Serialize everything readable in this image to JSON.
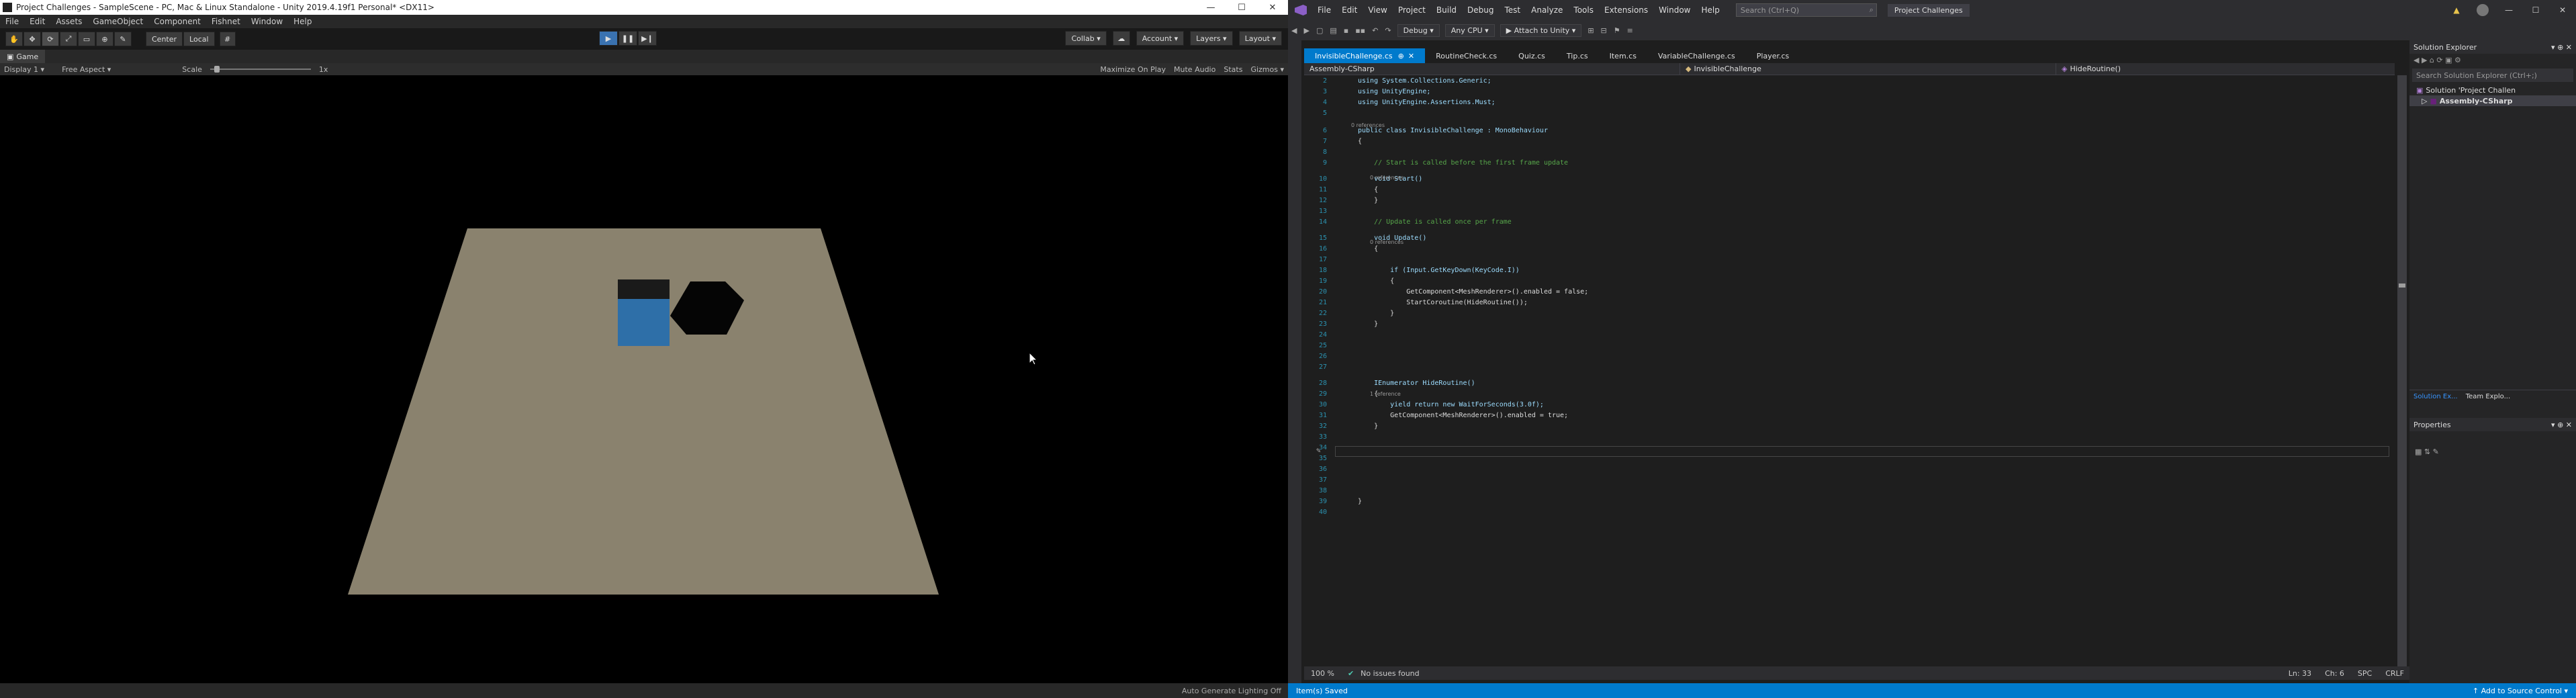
{
  "unity": {
    "title": "Project Challenges - SampleScene - PC, Mac & Linux Standalone - Unity 2019.4.19f1 Personal* <DX11>",
    "window_controls": [
      "—",
      "☐",
      "✕"
    ],
    "menu": [
      "File",
      "Edit",
      "Assets",
      "GameObject",
      "Component",
      "Fishnet",
      "Window",
      "Help"
    ],
    "toolbar": {
      "center_label": "Center",
      "local_label": "Local",
      "collab_label": "Collab ▾",
      "account_label": "Account ▾",
      "layers_label": "Layers ▾",
      "layout_label": "Layout ▾"
    },
    "game_tab": "Game",
    "game_toolbar": {
      "display": "Display 1 ▾",
      "aspect": "Free Aspect ▾",
      "scale_label": "Scale",
      "scale_value": "1x",
      "right": [
        "Maximize On Play",
        "Mute Audio",
        "Stats",
        "Gizmos ▾"
      ]
    },
    "status": "Auto Generate Lighting Off"
  },
  "vs": {
    "menu": [
      "File",
      "Edit",
      "View",
      "Project",
      "Build",
      "Debug",
      "Test",
      "Analyze",
      "Tools",
      "Extensions",
      "Window",
      "Help"
    ],
    "search_placeholder": "Search (Ctrl+Q)",
    "project_name": "Project Challenges",
    "toolbar": {
      "config": "Debug ▾",
      "platform": "Any CPU ▾",
      "attach": "▶ Attach to Unity ▾"
    },
    "tabs": [
      "InvisibleChallenge.cs",
      "RoutineCheck.cs",
      "Quiz.cs",
      "Tip.cs",
      "Item.cs",
      "VariableChallenge.cs",
      "Player.cs"
    ],
    "navbar": {
      "project": "Assembly-CSharp",
      "class": "InvisibleChallenge",
      "member": "HideRoutine()"
    },
    "code": [
      {
        "n": "2",
        "t": "using System.Collections.Generic;"
      },
      {
        "n": "3",
        "t": "using UnityEngine;"
      },
      {
        "n": "4",
        "t": "using UnityEngine.Assertions.Must;"
      },
      {
        "n": "5",
        "t": ""
      },
      {
        "n": "6",
        "t": "public class InvisibleChallenge : MonoBehaviour"
      },
      {
        "n": "7",
        "t": "{"
      },
      {
        "n": "8",
        "t": ""
      },
      {
        "n": "9",
        "t": "    // Start is called before the first frame update"
      },
      {
        "n": "10",
        "t": "    void Start()"
      },
      {
        "n": "11",
        "t": "    {"
      },
      {
        "n": "12",
        "t": "    }"
      },
      {
        "n": "13",
        "t": ""
      },
      {
        "n": "14",
        "t": "    // Update is called once per frame"
      },
      {
        "n": "15",
        "t": "    void Update()"
      },
      {
        "n": "16",
        "t": "    {"
      },
      {
        "n": "17",
        "t": ""
      },
      {
        "n": "18",
        "t": "        if (Input.GetKeyDown(KeyCode.I))"
      },
      {
        "n": "19",
        "t": "        {"
      },
      {
        "n": "20",
        "t": "            GetComponent<MeshRenderer>().enabled = false;"
      },
      {
        "n": "21",
        "t": "            StartCoroutine(HideRoutine());"
      },
      {
        "n": "22",
        "t": "        }"
      },
      {
        "n": "23",
        "t": "    }"
      },
      {
        "n": "24",
        "t": ""
      },
      {
        "n": "25",
        "t": ""
      },
      {
        "n": "26",
        "t": ""
      },
      {
        "n": "27",
        "t": ""
      },
      {
        "n": "28",
        "t": "    IEnumerator HideRoutine()"
      },
      {
        "n": "29",
        "t": "    {"
      },
      {
        "n": "30",
        "t": "        yield return new WaitForSeconds(3.0f);"
      },
      {
        "n": "31",
        "t": "        GetComponent<MeshRenderer>().enabled = true;"
      },
      {
        "n": "32",
        "t": "    }"
      },
      {
        "n": "33",
        "t": ""
      },
      {
        "n": "34",
        "t": ""
      },
      {
        "n": "35",
        "t": ""
      },
      {
        "n": "36",
        "t": ""
      },
      {
        "n": "37",
        "t": ""
      },
      {
        "n": "38",
        "t": ""
      },
      {
        "n": "39",
        "t": "}"
      },
      {
        "n": "40",
        "t": ""
      }
    ],
    "references": [
      "0 references",
      "0 references",
      "0 references",
      "1 reference"
    ],
    "editor_status": {
      "zoom": "100 %",
      "issues": "No issues found",
      "ln": "Ln: 33",
      "ch": "Ch: 6",
      "spc": "SPC",
      "crlf": "CRLF"
    },
    "solution_explorer": {
      "title": "Solution Explorer",
      "search": "Search Solution Explorer (Ctrl+;)",
      "items": [
        "Solution 'Project Challen",
        "Assembly-CSharp"
      ],
      "tabs": [
        "Solution Ex...",
        "Team Explo..."
      ]
    },
    "properties_title": "Properties",
    "status": {
      "left": "Item(s) Saved",
      "right": "↑ Add to Source Control ▾"
    }
  }
}
